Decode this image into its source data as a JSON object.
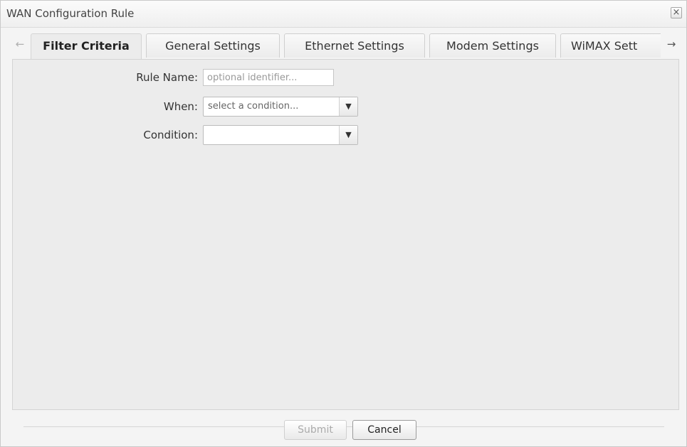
{
  "window": {
    "title": "WAN Configuration Rule",
    "close_glyph": "×"
  },
  "tabs": {
    "scroll_left_glyph": "←",
    "scroll_right_glyph": "→",
    "items": [
      {
        "label": "Filter Criteria",
        "active": true
      },
      {
        "label": "General Settings",
        "active": false
      },
      {
        "label": "Ethernet Settings",
        "active": false
      },
      {
        "label": "Modem Settings",
        "active": false
      },
      {
        "label": "WiMAX Sett",
        "active": false
      }
    ]
  },
  "form": {
    "rule_name": {
      "label": "Rule Name:",
      "placeholder": "optional identifier...",
      "value": ""
    },
    "when": {
      "label": "When:",
      "selected": "select a condition..."
    },
    "condition": {
      "label": "Condition:",
      "selected": ""
    }
  },
  "footer": {
    "submit_label": "Submit",
    "cancel_label": "Cancel"
  }
}
